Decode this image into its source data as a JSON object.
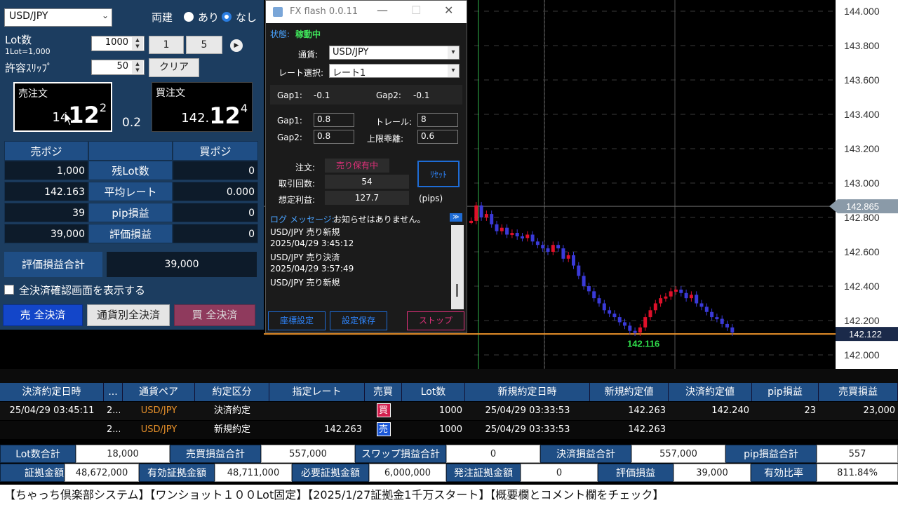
{
  "left_panel": {
    "currency": "USD/JPY",
    "ryodate_label": "両建",
    "opt_ari": "あり",
    "opt_nashi": "なし",
    "lot_label": "Lot数",
    "lot_sub": "1Lot=1,000",
    "lot_value": "1000",
    "btn_1": "1",
    "btn_5": "5",
    "slip_label": "許容ｽﾘｯﾌﾟ",
    "slip_value": "50",
    "clear": "クリア",
    "sell_title": "売注文",
    "sell_price_prefix": "14",
    "sell_price_big": "12",
    "sell_price_sup": "2",
    "spread": "0.2",
    "buy_title": "買注文",
    "buy_price_prefix": "142.",
    "buy_price_big": "12",
    "buy_price_sup": "4",
    "sell_pos_header": "売ポジ",
    "buy_pos_header": "買ポジ",
    "rows": [
      {
        "left": "1,000",
        "label": "残Lot数",
        "right": "0"
      },
      {
        "left": "142.163",
        "label": "平均レート",
        "right": "0.000"
      },
      {
        "left": "39",
        "label": "pip損益",
        "right": "0"
      },
      {
        "left": "39,000",
        "label": "評価損益",
        "right": "0"
      }
    ],
    "total_label": "評価損益合計",
    "total_value": "39,000",
    "confirm_label": "全決済確認画面を表示する",
    "sell_all": "売 全決済",
    "by_currency": "通貨別全決済",
    "buy_all": "買 全決済"
  },
  "dialog": {
    "title": "FX flash 0.0.11",
    "status_label": "状態:",
    "status_value": "稼動中",
    "currency_label": "通貨:",
    "currency_value": "USD/JPY",
    "rate_label": "レート選択:",
    "rate_value": "レート1",
    "gap1_label": "Gap1:",
    "gap1_value": "-0.1",
    "gap2_label": "Gap2:",
    "gap2_value": "-0.1",
    "gap1b_label": "Gap1:",
    "gap1b_value": "0.8",
    "trail_label": "トレール:",
    "trail_value": "8",
    "gap2b_label": "Gap2:",
    "gap2b_value": "0.8",
    "limit_label": "上限乖離:",
    "limit_value": "0.6",
    "order_label": "注文:",
    "order_value": "売り保有中",
    "count_label": "取引回数:",
    "count_value": "54",
    "profit_label": "想定利益:",
    "profit_value": "127.7",
    "pips": "(pips)",
    "reset": "ﾘｾｯﾄ",
    "log_label": "ログ",
    "msg_label": "メッセージ:",
    "msg_value": "お知らせはありません。",
    "log_lines": [
      "USD/JPY 売り新規",
      "2025/04/29 3:45:12",
      "USD/JPY 売り決済",
      "2025/04/29 3:57:49",
      "USD/JPY 売り新規"
    ],
    "coord": "座標設定",
    "save": "設定保存",
    "stop": "ストップ"
  },
  "chart": {
    "price_labels": [
      "144.000",
      "143.800",
      "143.600",
      "143.400",
      "143.200",
      "143.000",
      "142.800",
      "142.600",
      "142.400",
      "142.200",
      "142.000"
    ],
    "current_marker": "142.865",
    "bid_marker": "142.122",
    "low_label": "142.116",
    "colors": {
      "up": "#e0102a",
      "down": "#3a3ad8",
      "line": "#e8912a"
    }
  },
  "table": {
    "headers": [
      "決済約定日時",
      "...",
      "通貨ペア",
      "約定区分",
      "指定レート",
      "売買",
      "Lot数",
      "新規約定日時",
      "新規約定値",
      "決済約定値",
      "pip損益",
      "売買損益"
    ],
    "rows": [
      [
        "25/04/29 03:45:11",
        "2...",
        "USD/JPY",
        "決済約定",
        "",
        "買",
        "1000",
        "25/04/29 03:33:53",
        "142.263",
        "142.240",
        "23",
        "23,000"
      ],
      [
        "",
        "2...",
        "USD/JPY",
        "新規約定",
        "142.263",
        "売",
        "1000",
        "25/04/29 03:33:53",
        "142.263",
        "",
        "",
        ""
      ]
    ]
  },
  "summary": {
    "row1": [
      [
        "Lot数合計",
        "18,000"
      ],
      [
        "売買損益合計",
        "557,000"
      ],
      [
        "スワップ損益合計",
        "0"
      ],
      [
        "決済損益合計",
        "557,000"
      ],
      [
        "pip損益合計",
        "557"
      ]
    ],
    "row2": [
      [
        "証拠金額",
        "48,672,000"
      ],
      [
        "有効証拠金額",
        "48,711,000"
      ],
      [
        "必要証拠金額",
        "6,000,000"
      ],
      [
        "発注証拠金額",
        "0"
      ],
      [
        "評価損益",
        "39,000"
      ],
      [
        "有効比率",
        "811.84%"
      ]
    ]
  },
  "banner": "【ちゃっち倶楽部システム】【ワンショット１００Lot固定】【2025/1/27証拠金1千万スタート】【概要欄とコメント欄をチェック】"
}
